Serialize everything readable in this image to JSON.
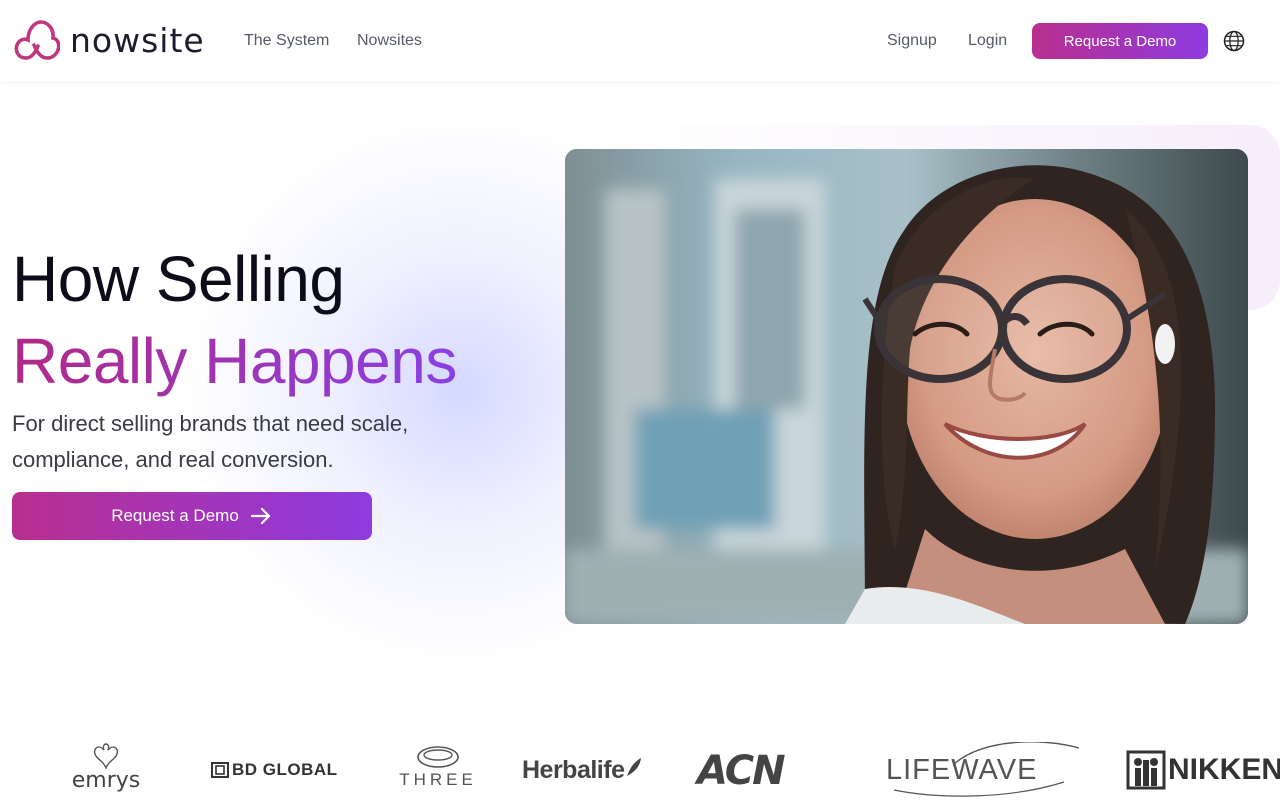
{
  "header": {
    "brand": "nowsite",
    "nav": [
      {
        "label": "The System"
      },
      {
        "label": "Nowsites"
      }
    ],
    "signup": "Signup",
    "login": "Login",
    "cta": "Request a Demo"
  },
  "hero": {
    "title_line1": "How Selling",
    "title_line2": "Really Happens",
    "subtitle": "For direct selling brands that need scale, compliance, and real conversion.",
    "cta": "Request a Demo"
  },
  "brands": {
    "logos": [
      "emrys",
      "BD GLOBAL",
      "THREE",
      "Herbalife",
      "ACN",
      "LIFEWAVE",
      "NIKKEN"
    ]
  },
  "colors": {
    "accent_start": "#b92f8f",
    "accent_end": "#8e3be0"
  }
}
